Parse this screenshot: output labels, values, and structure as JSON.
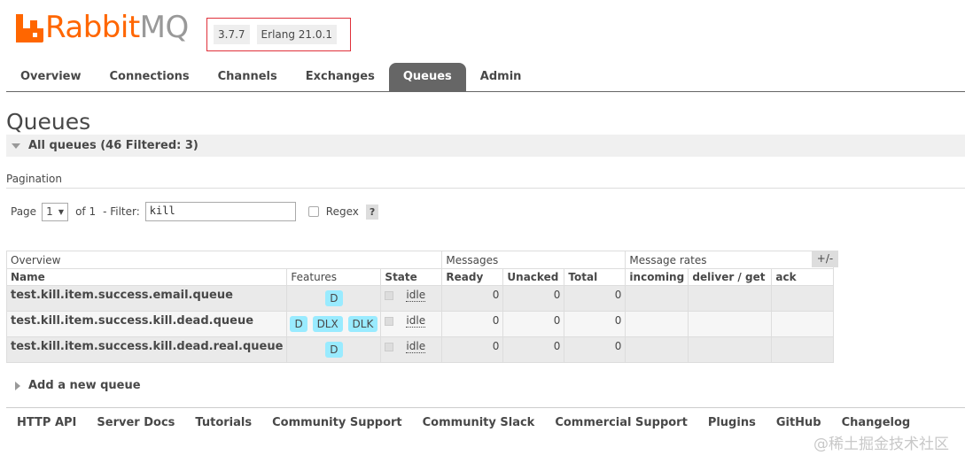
{
  "brand": {
    "name_primary": "Rabbit",
    "name_secondary": "MQ",
    "accent": "#ff6600"
  },
  "versions": {
    "rabbitmq": "3.7.7",
    "erlang": "Erlang 21.0.1"
  },
  "tabs": [
    "Overview",
    "Connections",
    "Channels",
    "Exchanges",
    "Queues",
    "Admin"
  ],
  "active_tab": "Queues",
  "page_title": "Queues",
  "section_title": "All queues (46 Filtered: 3)",
  "pagination": {
    "label": "Pagination",
    "page_label": "Page",
    "page_value": "1",
    "of_label": "of 1",
    "filter_label": "- Filter:",
    "filter_value": "kill",
    "regex_label": "Regex",
    "help_label": "?"
  },
  "table": {
    "groups": {
      "overview": "Overview",
      "messages": "Messages",
      "rates": "Message rates"
    },
    "columns": {
      "name": "Name",
      "features": "Features",
      "state": "State",
      "ready": "Ready",
      "unacked": "Unacked",
      "total": "Total",
      "incoming": "incoming",
      "deliver": "deliver / get",
      "ack": "ack"
    },
    "toggle": "+/-",
    "rows": [
      {
        "name": "test.kill.item.success.email.queue",
        "features": [
          "D"
        ],
        "state": "idle",
        "ready": "0",
        "unacked": "0",
        "total": "0",
        "incoming": "",
        "deliver": "",
        "ack": ""
      },
      {
        "name": "test.kill.item.success.kill.dead.queue",
        "features": [
          "D",
          "DLX",
          "DLK"
        ],
        "state": "idle",
        "ready": "0",
        "unacked": "0",
        "total": "0",
        "incoming": "",
        "deliver": "",
        "ack": ""
      },
      {
        "name": "test.kill.item.success.kill.dead.real.queue",
        "features": [
          "D"
        ],
        "state": "idle",
        "ready": "0",
        "unacked": "0",
        "total": "0",
        "incoming": "",
        "deliver": "",
        "ack": ""
      }
    ]
  },
  "add_queue": "Add a new queue",
  "footer_links": [
    "HTTP API",
    "Server Docs",
    "Tutorials",
    "Community Support",
    "Community Slack",
    "Commercial Support",
    "Plugins",
    "GitHub",
    "Changelog"
  ],
  "watermark": "@稀土掘金技术社区"
}
